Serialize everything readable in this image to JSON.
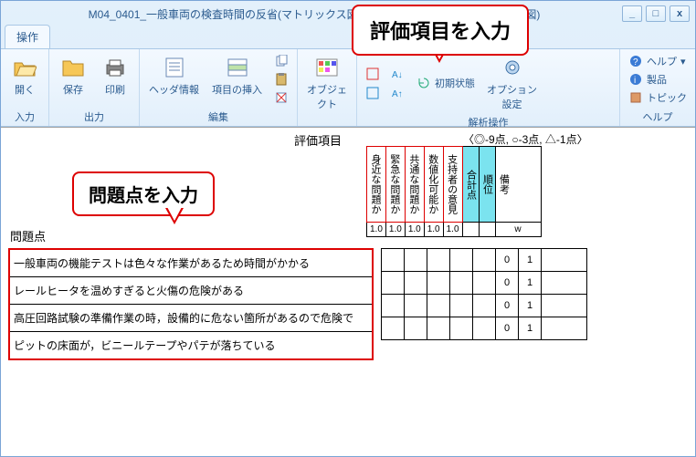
{
  "window": {
    "title": "M04_0401_一般車両の検査時間の反省(マトリックス図).MX7 - Juse 新QC7(マトリックス図)"
  },
  "tab": {
    "label": "操作"
  },
  "ribbon": {
    "groups": {
      "input": {
        "label": "入力",
        "open": "開く"
      },
      "output": {
        "label": "出力",
        "save": "保存",
        "print": "印刷"
      },
      "edit": {
        "label": "編集",
        "header": "ヘッダ情報",
        "insert": "項目の挿入",
        "copy": "コピー",
        "paste": "貼り付け",
        "delete": "項目の削除"
      },
      "object": {
        "label": "オブジェクト",
        "btn": "オブジェクト"
      },
      "parse": {
        "label": "解析操作",
        "option": "オプション設定",
        "initial": "初期状態",
        "r1": "",
        "r2": "",
        "r3": "",
        "r4": ""
      },
      "help": {
        "label": "ヘルプ",
        "help": "ヘルプ",
        "product": "製品",
        "topic": "トピック"
      }
    }
  },
  "callouts": {
    "issues": "問題点を入力",
    "eval": "評価項目を入力"
  },
  "main": {
    "eval_label": "評価項目",
    "legend": "〈◎-9点, ○-3点, △-1点〉",
    "issue_label": "問題点",
    "eval_headers": [
      "身近な問題か",
      "緊急な問題か",
      "共通な問題か",
      "数値化可能か",
      "支持者の意見"
    ],
    "sum_headers": [
      "合計点",
      "順位",
      "備考"
    ],
    "header_nums": [
      "1.0",
      "1.0",
      "1.0",
      "1.0",
      "1.0",
      "",
      "",
      "w"
    ],
    "issues": [
      "一般車両の機能テストは色々な作業があるため時間がかかる",
      "レールヒータを温めすぎると火傷の危険がある",
      "高圧回路試験の準備作業の時，設備的に危ない箇所があるので危険で",
      "ピットの床面が，ビニールテープやパテが落ちている"
    ],
    "grid": [
      [
        "",
        "",
        "",
        "",
        "",
        "0",
        "1",
        ""
      ],
      [
        "",
        "",
        "",
        "",
        "",
        "0",
        "1",
        ""
      ],
      [
        "",
        "",
        "",
        "",
        "",
        "0",
        "1",
        ""
      ],
      [
        "",
        "",
        "",
        "",
        "",
        "0",
        "1",
        ""
      ]
    ]
  }
}
